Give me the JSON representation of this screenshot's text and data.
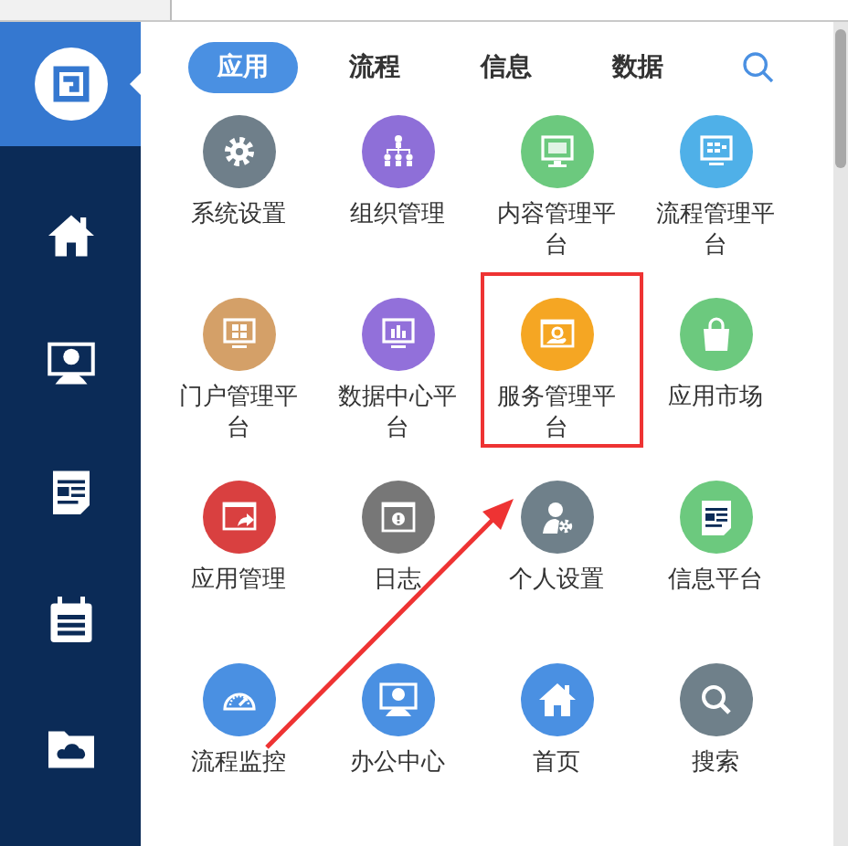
{
  "sidebar": {
    "items": [
      {
        "kind": "home"
      },
      {
        "kind": "monitor-person"
      },
      {
        "kind": "news"
      },
      {
        "kind": "calendar"
      },
      {
        "kind": "cloud-folder"
      }
    ]
  },
  "tabs": [
    {
      "label": "应用",
      "selected": true
    },
    {
      "label": "流程",
      "selected": false
    },
    {
      "label": "信息",
      "selected": false
    },
    {
      "label": "数据",
      "selected": false
    }
  ],
  "apps": [
    {
      "label": "系统设置",
      "kind": "gear",
      "color": "#6f7f8a",
      "highlighted": false
    },
    {
      "label": "组织管理",
      "kind": "org",
      "color": "#8e6fd8",
      "highlighted": false
    },
    {
      "label": "内容管理平台",
      "kind": "monitor-doc",
      "color": "#6cc97e",
      "highlighted": false
    },
    {
      "label": "流程管理平台",
      "kind": "monitor-dots",
      "color": "#4fb0e8",
      "highlighted": false
    },
    {
      "label": "门户管理平台",
      "kind": "monitor-tiles",
      "color": "#d4a068",
      "highlighted": false
    },
    {
      "label": "数据中心平台",
      "kind": "monitor-chart",
      "color": "#9270da",
      "highlighted": false
    },
    {
      "label": "服务管理平台",
      "kind": "window-gear",
      "color": "#f5a623",
      "highlighted": true
    },
    {
      "label": "应用市场",
      "kind": "bag",
      "color": "#6cc97e",
      "highlighted": false
    },
    {
      "label": "应用管理",
      "kind": "window-arrow",
      "color": "#d94040",
      "highlighted": false
    },
    {
      "label": "日志",
      "kind": "window-alert",
      "color": "#777777",
      "highlighted": false
    },
    {
      "label": "个人设置",
      "kind": "user-gear",
      "color": "#6f808a",
      "highlighted": false
    },
    {
      "label": "信息平台",
      "kind": "news",
      "color": "#6cc97e",
      "highlighted": false
    },
    {
      "label": "流程监控",
      "kind": "gauge",
      "color": "#4a90e2",
      "highlighted": false
    },
    {
      "label": "办公中心",
      "kind": "monitor-person",
      "color": "#4a90e2",
      "highlighted": false
    },
    {
      "label": "首页",
      "kind": "home",
      "color": "#4a90e2",
      "highlighted": false
    },
    {
      "label": "搜索",
      "kind": "search",
      "color": "#6f808a",
      "highlighted": false
    }
  ]
}
